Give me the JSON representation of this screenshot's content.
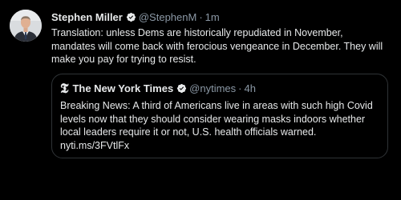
{
  "tweet": {
    "author_name": "Stephen Miller",
    "handle": "@StephenM",
    "separator": "·",
    "time": "1m",
    "text": "Translation: unless Dems are historically repudiated in November, mandates will come back with ferocious vengeance in December. They will make you pay for trying to resist.",
    "avatar_icon": "profile-photo",
    "verified_icon": "verified-badge-icon"
  },
  "quoted": {
    "logo_glyph": "𝕿",
    "author_name": "The New York Times",
    "handle": "@nytimes",
    "separator": "·",
    "time": "4h",
    "text": "Breaking News: A third of Americans live in areas with such high Covid levels now that they should consider wearing masks indoors whether local leaders require it or not, U.S. health officials warned.",
    "link": "nyti.ms/3FVtlFx"
  },
  "colors": {
    "background": "#000000",
    "text": "#e7e9ea",
    "secondary": "#8b98a5",
    "border": "#2f3336",
    "verified": "#e7e9ea"
  }
}
